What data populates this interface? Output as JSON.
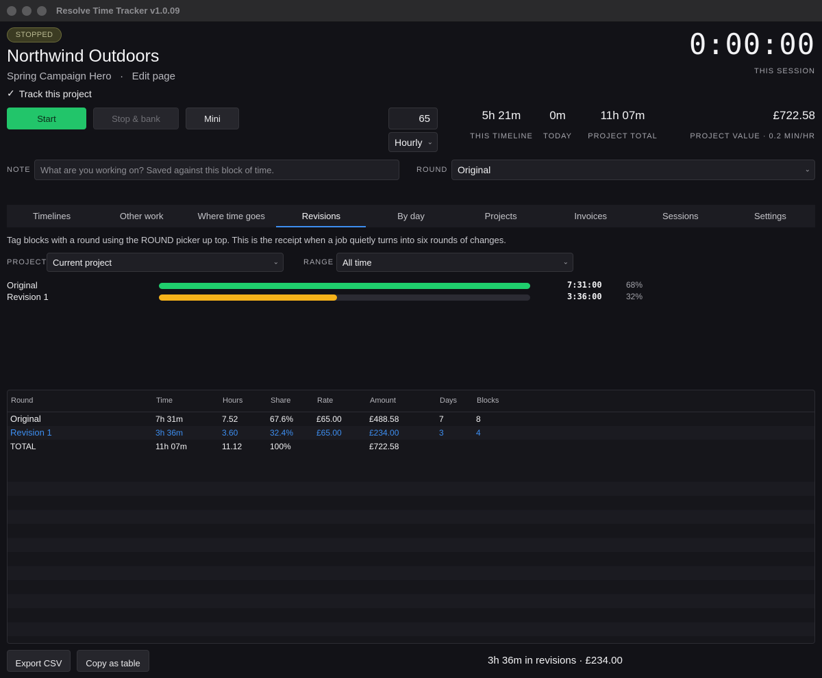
{
  "window": {
    "title": "Resolve Time Tracker  v1.0.09"
  },
  "status": {
    "badge": "STOPPED"
  },
  "project": {
    "name": "Northwind Outdoors",
    "timeline": "Spring Campaign Hero",
    "separator": "·",
    "edit_link": "Edit page",
    "track_label": "Track this project",
    "track_checked": true
  },
  "session": {
    "timer": "0:00:00",
    "label": "THIS SESSION"
  },
  "controls": {
    "start": "Start",
    "stop_bank": "Stop & bank",
    "mini": "Mini",
    "rate_value": "65",
    "rate_unit": "Hourly"
  },
  "stats": [
    {
      "value": "5h 21m",
      "label": "THIS TIMELINE"
    },
    {
      "value": "0m",
      "label": "TODAY"
    },
    {
      "value": "11h 07m",
      "label": "PROJECT TOTAL"
    },
    {
      "value": "£722.58",
      "label": "PROJECT VALUE · 0.2 MIN/HR"
    }
  ],
  "note": {
    "label": "NOTE",
    "placeholder": "What are you working on? Saved against this block of time."
  },
  "round": {
    "label": "ROUND",
    "value": "Original"
  },
  "tabs": [
    "Timelines",
    "Other work",
    "Where time goes",
    "Revisions",
    "By day",
    "Projects",
    "Invoices",
    "Sessions",
    "Settings"
  ],
  "active_tab": "Revisions",
  "revisions": {
    "help_text": "Tag blocks with a round using the ROUND picker up top. This is the receipt when a job quietly turns into six rounds of changes.",
    "project_label": "PROJECT",
    "project_value": "Current project",
    "range_label": "RANGE",
    "range_value": "All time",
    "bars": [
      {
        "name": "Original",
        "duration": "7:31:00",
        "percent": "68%",
        "fraction": 1.0,
        "color": "#1fcf6d"
      },
      {
        "name": "Revision 1",
        "duration": "3:36:00",
        "percent": "32%",
        "fraction": 0.479,
        "color": "#f5b21a"
      }
    ]
  },
  "table": {
    "columns": [
      "Round",
      "Time",
      "Hours",
      "Share",
      "Rate",
      "Amount",
      "Days",
      "Blocks"
    ],
    "rows": [
      [
        "Original",
        "7h 31m",
        "7.52",
        "67.6%",
        "£65.00",
        "£488.58",
        "7",
        "8"
      ],
      [
        "Revision 1",
        "3h 36m",
        "3.60",
        "32.4%",
        "£65.00",
        "£234.00",
        "3",
        "4"
      ],
      [
        "TOTAL",
        "11h 07m",
        "11.12",
        "100%",
        "",
        "£722.58",
        "",
        ""
      ]
    ]
  },
  "footer": {
    "export_csv": "Export CSV",
    "copy_table": "Copy as table",
    "summary": "3h 36m in revisions  ·  £234.00"
  },
  "colors": {
    "accent": "#3d8ef0",
    "start": "#22c56a",
    "original": "#1fcf6d",
    "revision": "#f5b21a"
  }
}
